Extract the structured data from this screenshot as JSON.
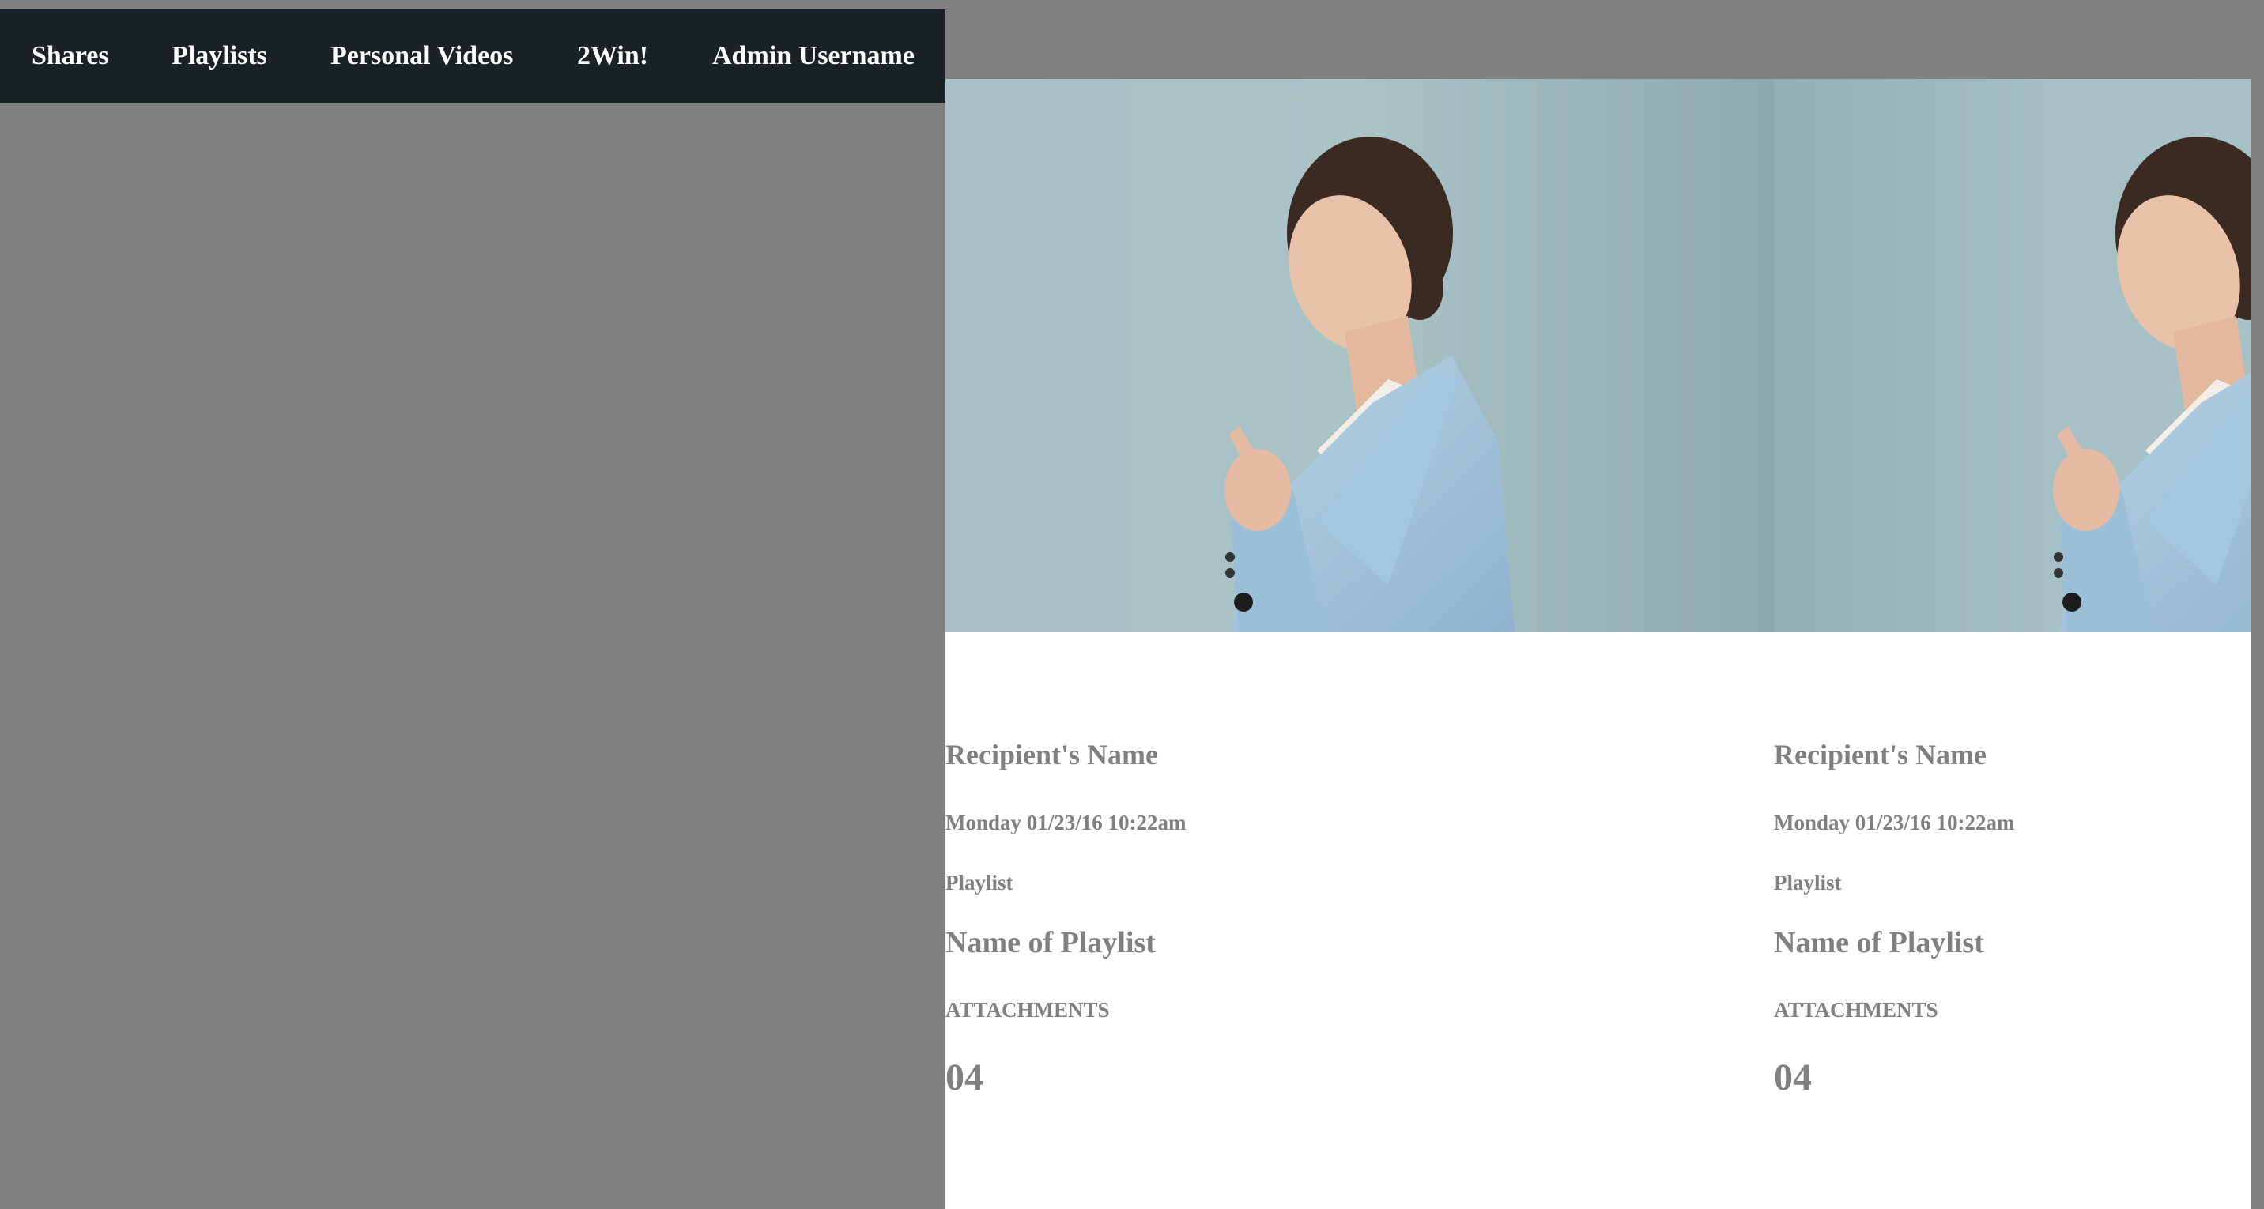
{
  "nav": {
    "items": [
      {
        "label": "Shares"
      },
      {
        "label": "Playlists"
      },
      {
        "label": "Personal Videos"
      },
      {
        "label": "2Win!"
      },
      {
        "label": "Admin Username"
      }
    ]
  },
  "cards": [
    {
      "recipient": "Recipient's Name",
      "date": "Monday 01/23/16 10:22am",
      "type": "Playlist",
      "playlist_name": "Name of Playlist",
      "attachments_label": "ATTACHMENTS",
      "attachments_count": "04"
    },
    {
      "recipient": "Recipient's Name",
      "date": "Monday 01/23/16 10:22am",
      "type": "Playlist",
      "playlist_name": "Name of Playlist",
      "attachments_label": "ATTACHMENTS",
      "attachments_count": "04"
    }
  ],
  "colors": {
    "backdrop": "#808080",
    "nav_background": "#1a2225",
    "nav_text": "#ffffff",
    "card_background": "#ffffff",
    "card_text": "#808080",
    "photo_background": "#a7c1c6",
    "blazer": "#a9c9e0"
  }
}
